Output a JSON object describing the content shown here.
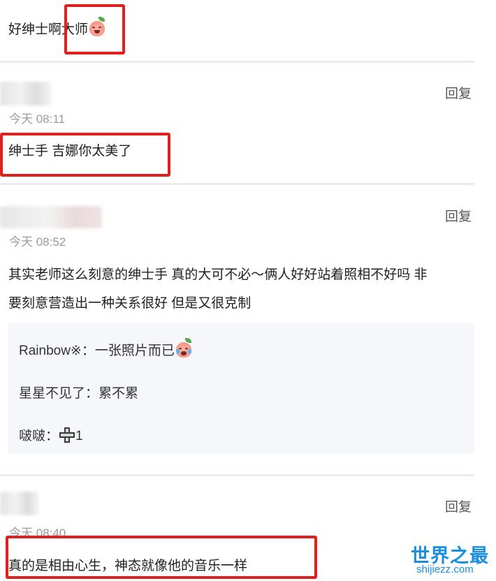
{
  "top_comment": {
    "text": "好绅士啊大师",
    "emoji": "peach-smile-emoji"
  },
  "comments": [
    {
      "time": "今天 08:11",
      "reply_label": "回复",
      "text": "绅士手 吉娜你太美了"
    },
    {
      "time": "今天 08:52",
      "reply_label": "回复",
      "text_line1": "其实老师这么刻意的绅士手 真的大可不必～俩人好好站着照相不好吗 非",
      "text_line2": "要刻意营造出一种关系很好 但是又很克制",
      "sub_replies": [
        {
          "text": "Rainbow※：一张照片而已",
          "emoji": "peach-crying-emoji"
        },
        {
          "text": "星星不见了：累不累"
        },
        {
          "text": "啵啵：",
          "suffix": "1",
          "icon": "plus-icon"
        }
      ]
    },
    {
      "time": "今天 08:40",
      "reply_label": "回复",
      "text": "真的是相由心生，神态就像他的音乐一样"
    }
  ],
  "watermark": {
    "title": "世界之最",
    "url": "shijiezz.com"
  },
  "colors": {
    "highlight_border": "#e0201c",
    "watermark": "#1a8fe0"
  }
}
